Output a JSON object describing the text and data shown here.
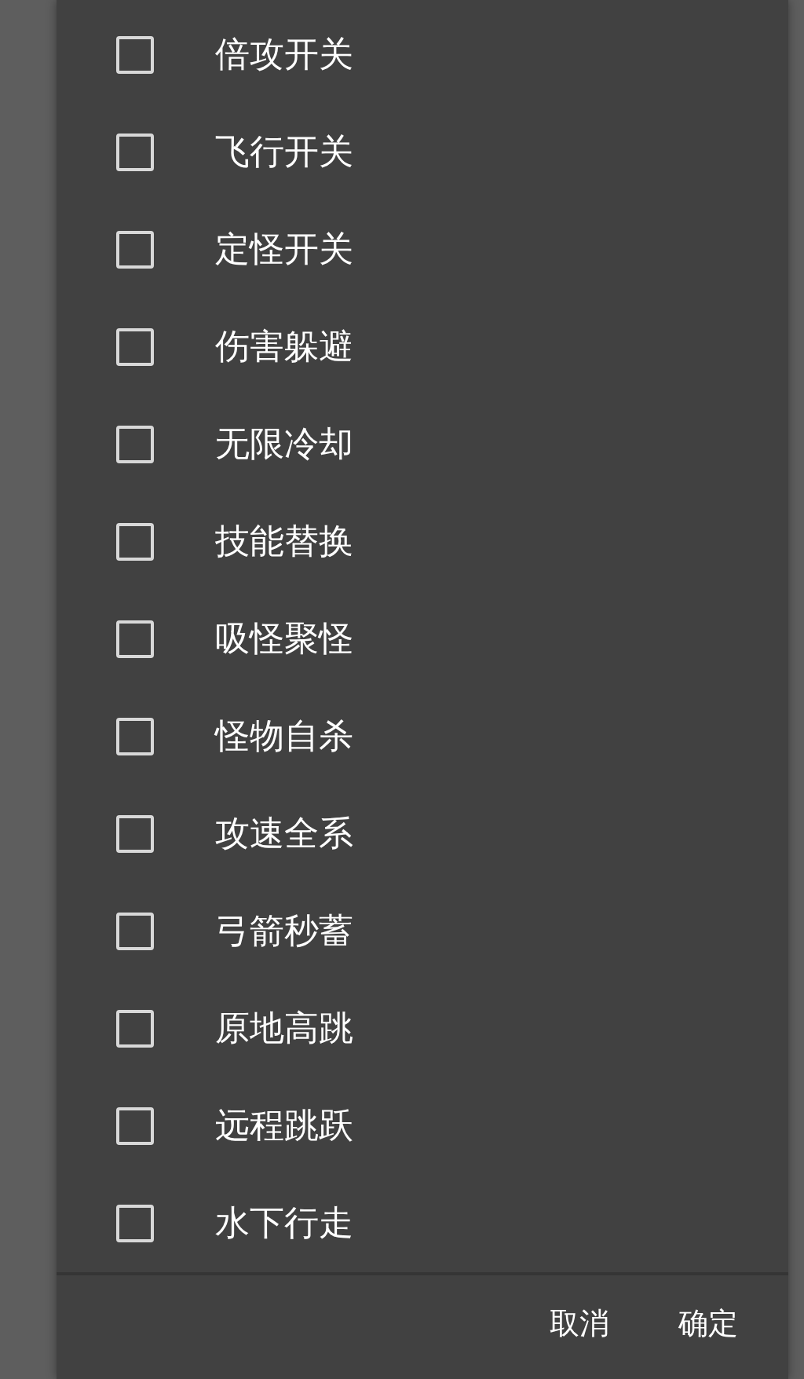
{
  "options": [
    {
      "label": "倍攻开关",
      "checked": false
    },
    {
      "label": "飞行开关",
      "checked": false
    },
    {
      "label": "定怪开关",
      "checked": false
    },
    {
      "label": "伤害躲避",
      "checked": false
    },
    {
      "label": "无限冷却",
      "checked": false
    },
    {
      "label": "技能替换",
      "checked": false
    },
    {
      "label": "吸怪聚怪",
      "checked": false
    },
    {
      "label": "怪物自杀",
      "checked": false
    },
    {
      "label": "攻速全系",
      "checked": false
    },
    {
      "label": "弓箭秒蓄",
      "checked": false
    },
    {
      "label": "原地高跳",
      "checked": false
    },
    {
      "label": "远程跳跃",
      "checked": false
    },
    {
      "label": "水下行走",
      "checked": false
    }
  ],
  "buttons": [
    "取消",
    "确定"
  ]
}
